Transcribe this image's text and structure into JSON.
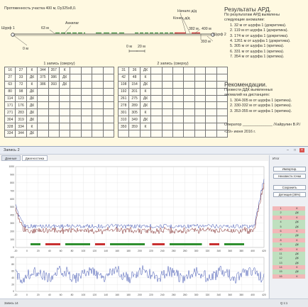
{
  "schematic": {
    "length_label": "Протяженность участка 400 м, Dy325x8,0.",
    "start_label": "Шурф 1",
    "end_label": "Шурф 2",
    "pos_0": "0 м",
    "pos_63": "63 м",
    "anchor_label": "Анкилаг",
    "defect_start_label": "Начало д/д",
    "defect_end_label": "Конец д/д",
    "pos_382": "382 м",
    "pos_400": "400 м",
    "pos_393": "393 м",
    "scale_0": "0 м",
    "scale_20": "20 м"
  },
  "table1": {
    "title": "1 запись (сверху)",
    "rows": [
      [
        "16",
        "27",
        "К",
        "344",
        "357",
        "К",
        "",
        "",
        "",
        ""
      ],
      [
        "27",
        "33",
        "ДК",
        "375",
        "386",
        "ДК",
        "",
        "",
        "",
        ""
      ],
      [
        "63",
        "72",
        "К",
        "386",
        "393",
        "ДК",
        "",
        "",
        "",
        ""
      ],
      [
        "80",
        "98",
        "ДК",
        "",
        "",
        "",
        "",
        "",
        "",
        ""
      ],
      [
        "114",
        "123",
        "ДК",
        "",
        "",
        "",
        "",
        "",
        "",
        ""
      ],
      [
        "171",
        "176",
        "ДК",
        "",
        "",
        "",
        "",
        "",
        "",
        ""
      ],
      [
        "271",
        "283",
        "ДК",
        "",
        "",
        "",
        "",
        "",
        "",
        ""
      ],
      [
        "304",
        "319",
        "ДК",
        "",
        "",
        "",
        "",
        "",
        "",
        ""
      ],
      [
        "328",
        "334",
        "К",
        "",
        "",
        "",
        "",
        "",
        "",
        ""
      ],
      [
        "334",
        "344",
        "ДК",
        "",
        "",
        "",
        "",
        "",
        "",
        ""
      ]
    ]
  },
  "table2": {
    "title": "2 запись (сверху)",
    "rows": [
      [
        "31",
        "36",
        "ДК",
        "",
        "",
        "",
        "",
        "",
        "",
        ""
      ],
      [
        "42",
        "48",
        "К",
        "",
        "",
        "",
        "",
        "",
        "",
        ""
      ],
      [
        "108",
        "154",
        "ДК",
        "",
        "",
        "",
        "",
        "",
        "",
        ""
      ],
      [
        "192",
        "201",
        "К",
        "",
        "",
        "",
        "",
        "",
        "",
        ""
      ],
      [
        "261",
        "275",
        "ДК",
        "",
        "",
        "",
        "",
        "",
        "",
        ""
      ],
      [
        "278",
        "289",
        "ДК",
        "",
        "",
        "",
        "",
        "",
        "",
        ""
      ],
      [
        "301",
        "305",
        "К",
        "",
        "",
        "",
        "",
        "",
        "",
        ""
      ],
      [
        "310",
        "349",
        "ДК",
        "",
        "",
        "",
        "",
        "",
        "",
        ""
      ],
      [
        "350",
        "359",
        "К",
        "",
        "",
        "",
        "",
        "",
        "",
        ""
      ]
    ]
  },
  "results": {
    "heading": "Результаты АРД.",
    "intro": [
      "По результатам АРД  выявлены",
      "следующие аномалии:"
    ],
    "items": [
      "1. 32 м от шурфа 1 (докритика).",
      "2. 119 м от шурфа 1 (докритика).",
      "3. 174 м от шурфа 1 (докритика).",
      "4. 1261 м от шурфа 1 (докритика).",
      "5. 305 м от шурфа 1 (критика).",
      "6. 331 м от шурфа 1 (критика).",
      "7. 354 м от шурфа 1 (критика)."
    ]
  },
  "recommendations": {
    "heading": "Рекомендации.",
    "intro": [
      "Провести ДДК выявленных",
      "аномалий на дистанциях:"
    ],
    "items": [
      "1. 304-305 м от шурфа 1 (критика).",
      "2. 330-332 м от шурфа 1 (критика).",
      "3. 353-355 м от шурфа 1 (критика)."
    ],
    "operator": "Оператор ______________ /Хайрулин В.Р./",
    "date": "«29» июня 2016 г."
  },
  "window": {
    "title": "Запись 2",
    "tab1": "Данные",
    "tab2": "Диагностика",
    "side_header": "Итог",
    "btn1": "Импортир.",
    "btn2": "Неизвестн.точки",
    "btn3": "Сохранить",
    "btn4": "Детекция (36%)",
    "side_rows": [
      [
        "1",
        "К"
      ],
      [
        "2",
        "ДК"
      ],
      [
        "3",
        "К"
      ],
      [
        "4",
        "ДК"
      ],
      [
        "5",
        "ДК"
      ],
      [
        "6",
        "К"
      ],
      [
        "7",
        "ДК"
      ],
      [
        "8",
        "К"
      ],
      [
        "9",
        "ДК"
      ],
      [
        "10",
        "К"
      ],
      [
        "11",
        "ДК"
      ],
      [
        "12",
        "ДК"
      ],
      [
        "13",
        "ДК"
      ],
      [
        "14",
        "К"
      ],
      [
        "15",
        "ДК"
      ],
      [
        "16",
        "К"
      ]
    ],
    "status_left": "Запись 14",
    "status_right": "Q 1:1",
    "y_ticks_top": [
      "1000",
      "900",
      "800",
      "700",
      "600",
      "500",
      "400",
      "300",
      "200",
      "100",
      "0"
    ],
    "x_ticks": [
      "-20",
      "0",
      "20",
      "40",
      "60",
      "80",
      "100",
      "120",
      "140",
      "160",
      "180",
      "200",
      "220",
      "240",
      "260",
      "280",
      "300",
      "320",
      "340",
      "360",
      "380",
      "400",
      "420"
    ],
    "y_ticks_bot": [
      "100",
      "80",
      "60",
      "40",
      "20",
      "0"
    ],
    "readout": [
      "L = 0,00",
      "Δ = 0,00",
      "Off = 0,00"
    ]
  }
}
